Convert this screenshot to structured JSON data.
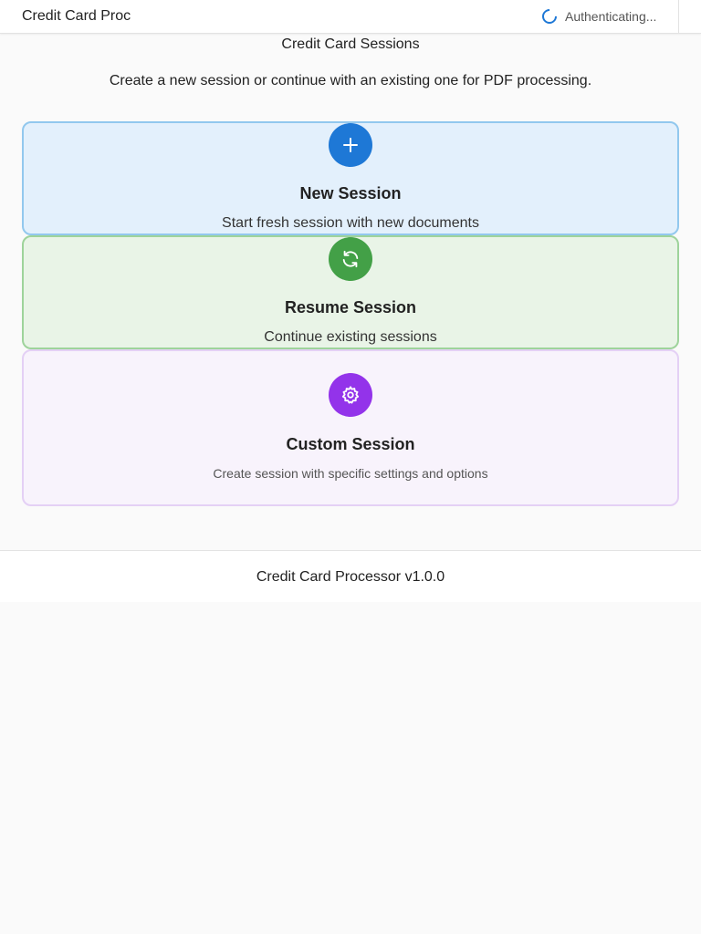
{
  "header": {
    "app_title": "Credit Card Proc",
    "auth_status": "Authenticating..."
  },
  "main": {
    "heading": "Credit Card Sessions",
    "intro": "Create a new session or continue with an existing one for PDF processing.",
    "cards": [
      {
        "title": "New Session",
        "description": "Start fresh session with new documents",
        "icon": "plus-icon",
        "accent_color": "#1e78d6"
      },
      {
        "title": "Resume Session",
        "description": "Continue existing sessions",
        "icon": "refresh-icon",
        "accent_color": "#43a047"
      },
      {
        "title": "Custom Session",
        "description": "Create session with specific settings and options",
        "icon": "gear-icon",
        "accent_color": "#9333ea"
      }
    ]
  },
  "footer": {
    "version_text": "Credit Card Processor v1.0.0"
  }
}
